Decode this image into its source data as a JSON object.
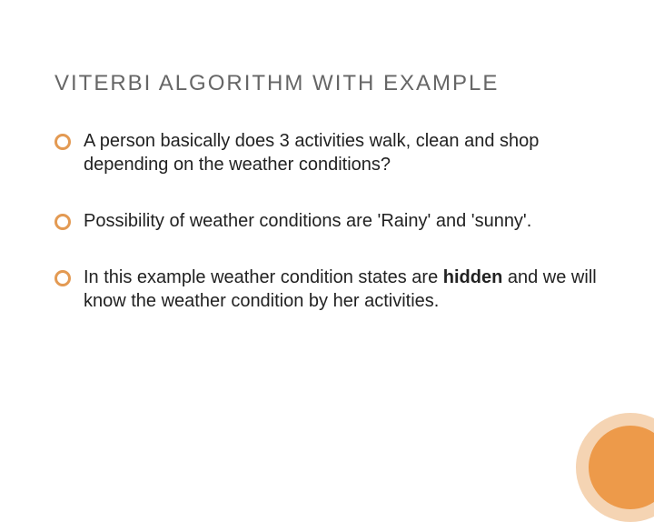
{
  "title": "VITERBI ALGORITHM WITH EXAMPLE",
  "bullets": [
    "A person basically does 3 activities  walk, clean and shop depending on the weather conditions?",
    "Possibility of weather conditions are 'Rainy' and 'sunny'.",
    "In this example weather condition states are <b>hidden</b> and we will know the weather condition by her activities."
  ]
}
